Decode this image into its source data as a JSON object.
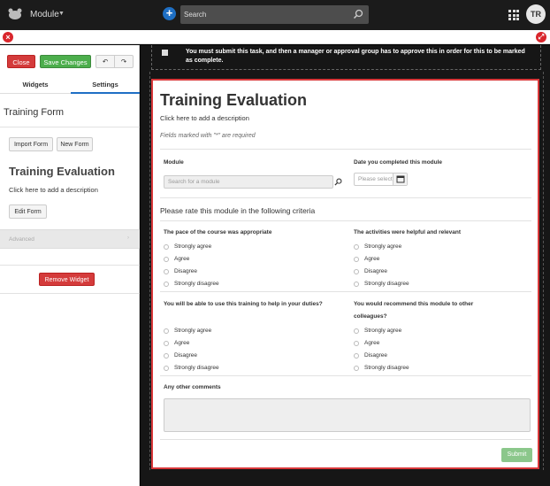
{
  "header": {
    "module_label": "Module",
    "search_placeholder": "Search",
    "avatar_initials": "TR"
  },
  "toolbar": {
    "close_label": "Close",
    "save_label": "Save Changes",
    "undo_icon": "undo-icon",
    "redo_icon": "redo-icon"
  },
  "left_panel": {
    "tabs": [
      {
        "label": "Widgets",
        "active": false
      },
      {
        "label": "Settings",
        "active": true
      }
    ],
    "form_heading": "Training Form",
    "import_label": "Import Form",
    "new_label": "New Form",
    "title": "Training Evaluation",
    "description": "Click here to add a description",
    "edit_label": "Edit Form",
    "advanced_label": "Advanced",
    "remove_label": "Remove Widget"
  },
  "notice": {
    "text": "You must submit this task, and then a manager or approval group has to approve this in order for this to be marked as complete."
  },
  "form": {
    "title": "Training Evaluation",
    "description": "Click here to add a description",
    "required_note": "Fields marked with \"*\" are required",
    "module_label": "Module",
    "module_placeholder": "Search for a module",
    "date_label": "Date you completed this module",
    "date_placeholder": "Please select",
    "criteria_heading": "Please rate this module in the following criteria",
    "questions": [
      {
        "label": "The pace of the course was appropriate"
      },
      {
        "label": "The activities were helpful and relevant"
      },
      {
        "label": "You will be able to use this training to help in your duties?"
      },
      {
        "label": "You would recommend this module to other colleagues?"
      }
    ],
    "options": [
      "Strongly agree",
      "Agree",
      "Disagree",
      "Strongly disagree"
    ],
    "comments_label": "Any other comments",
    "submit_label": "Submit"
  },
  "colors": {
    "accent_blue": "#1e6fc4",
    "danger_red": "#d43b3b",
    "success_green": "#4cae4c",
    "card_border": "#d9383a"
  }
}
